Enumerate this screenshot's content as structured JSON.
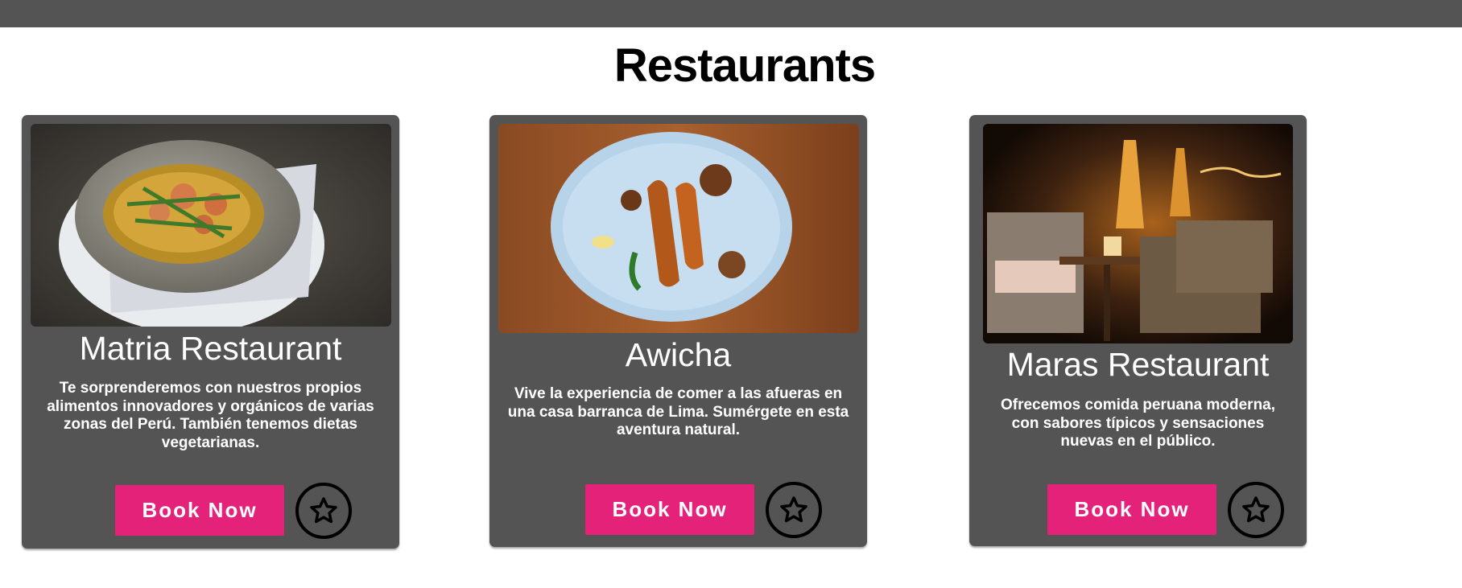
{
  "page": {
    "title": "Restaurants"
  },
  "theme": {
    "topbar": "#545454",
    "card_bg": "#545454",
    "button_accent": "#e5227a"
  },
  "restaurants": [
    {
      "name": "Matria Restaurant",
      "description": "Te sorprenderemos con nuestros propios alimentos innovadores y orgánicos de varias zonas del Perú. También tenemos dietas vegetarianas.",
      "book_label": "Book Now",
      "favorite_icon": "star-outline-icon",
      "image": "shrimp-dish-in-stone-bowl"
    },
    {
      "name": "Awicha",
      "description": "Vive la experiencia de comer a las afueras en una casa barranca de Lima. Sumérgete en esta aventura natural.",
      "book_label": "Book Now",
      "favorite_icon": "star-outline-icon",
      "image": "glazed-meat-on-blue-plate"
    },
    {
      "name": "Maras Restaurant",
      "description": "Ofrecemos comida peruana moderna, con sabores típicos y sensaciones nuevas en el público.",
      "book_label": "Book Now",
      "favorite_icon": "star-outline-icon",
      "image": "restaurant-terrace-interior"
    }
  ]
}
